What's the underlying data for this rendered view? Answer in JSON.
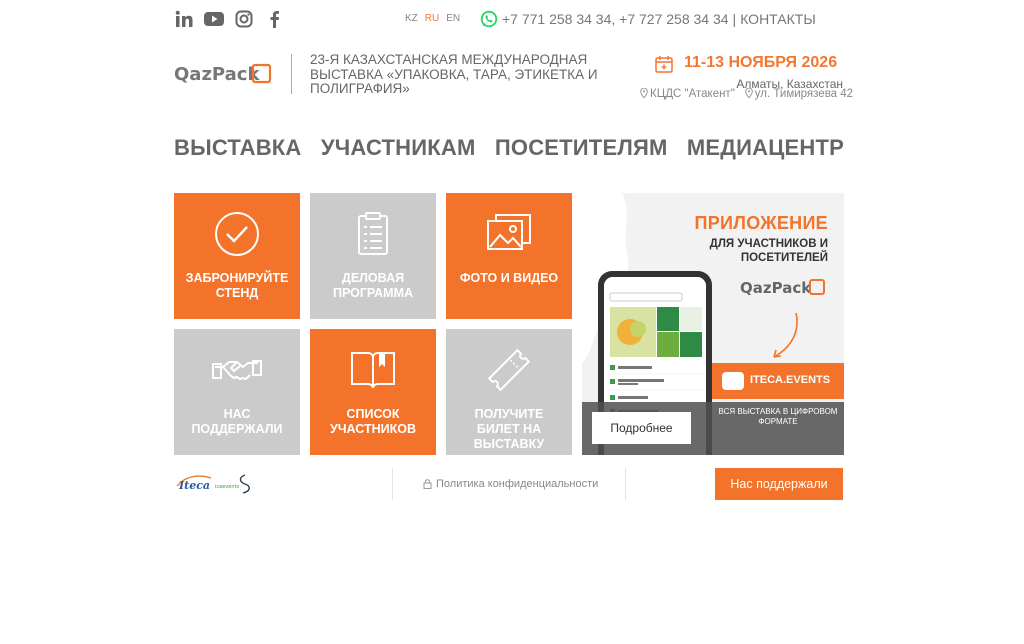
{
  "topbar": {
    "social": [
      "linkedin-icon",
      "youtube-icon",
      "instagram-icon",
      "facebook-icon"
    ],
    "languages": [
      {
        "code": "KZ",
        "active": false
      },
      {
        "code": "RU",
        "active": true
      },
      {
        "code": "EN",
        "active": false
      }
    ],
    "phones": "+7 771 258 34 34, +7 727 258 34 34",
    "separator": "|",
    "contacts_label": "КОНТАКТЫ"
  },
  "header": {
    "logo_text": "QazPack",
    "title": "23-я Казахстанская международная выставка «Упаковка, тара, этикетка и полиграфия»",
    "date": "11-13 НОЯБРЯ 2026",
    "city": "Алматы, Казахстан",
    "venue": "КЦДС \"Атакент\"",
    "address": "ул. Тимирязева 42"
  },
  "nav": {
    "items": [
      "ВЫСТАВКА",
      "УЧАСТНИКАМ",
      "ПОСЕТИТЕЛЯМ",
      "МЕДИАЦЕНТР"
    ]
  },
  "tiles": {
    "book": "ЗАБРОНИРУЙТЕ СТЕНД",
    "program": "ДЕЛОВАЯ ПРОГРАММА",
    "media": "ФОТО И ВИДЕО",
    "support": "НАС ПОДДЕРЖАЛИ",
    "exhibitors": "СПИСОК УЧАСТНИКОВ",
    "ticket": "ПОЛУЧИТЕ БИЛЕТ НА ВЫСТАВКУ"
  },
  "promo": {
    "title": "ПРИЛОЖЕНИЕ",
    "subtitle": "ДЛЯ УЧАСТНИКОВ И ПОСЕТИТЕЛЕЙ",
    "band_label": "ITECA.EVENTS",
    "digital": "ВСЯ ВЫСТАВКА В ЦИФРОВОМ ФОРМАТЕ",
    "more_button": "Подробнее"
  },
  "footer": {
    "privacy": "Политика конфиденциальности",
    "support_button": "Нас поддержали"
  },
  "colors": {
    "accent": "#f3732b",
    "gray_tile": "#cbcbcb",
    "whatsapp": "#25d366"
  }
}
